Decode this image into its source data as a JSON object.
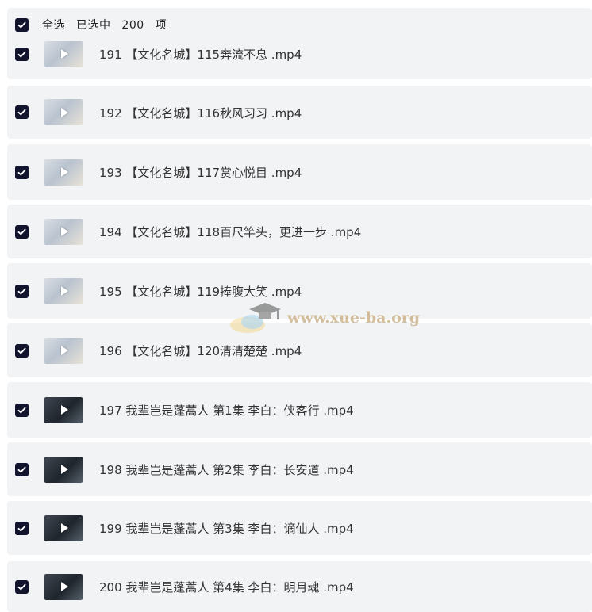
{
  "header": {
    "select_all_label": "全选",
    "selected_label": "已选中",
    "selected_count": "200",
    "unit_label": "项"
  },
  "files": [
    {
      "name": "191 【文化名城】115奔流不息 .mp4",
      "thumb": "light"
    },
    {
      "name": "192 【文化名城】116秋风习习 .mp4",
      "thumb": "light"
    },
    {
      "name": "193 【文化名城】117赏心悦目 .mp4",
      "thumb": "light"
    },
    {
      "name": "194 【文化名城】118百尺竿头，更进一步 .mp4",
      "thumb": "light"
    },
    {
      "name": "195 【文化名城】119捧腹大笑 .mp4",
      "thumb": "light"
    },
    {
      "name": "196 【文化名城】120清清楚楚 .mp4",
      "thumb": "light"
    },
    {
      "name": "197 我辈岂是蓬蒿人 第1集 李白：侠客行 .mp4",
      "thumb": "dark"
    },
    {
      "name": "198 我辈岂是蓬蒿人 第2集 李白：长安道 .mp4",
      "thumb": "dark"
    },
    {
      "name": "199 我辈岂是蓬蒿人 第3集 李白：谪仙人 .mp4",
      "thumb": "dark"
    },
    {
      "name": "200 我辈岂是蓬蒿人 第4集 李白：明月魂 .mp4",
      "thumb": "dark"
    }
  ],
  "icons": {
    "checkbox": "checkmark-icon",
    "thumbnail": "play-icon"
  },
  "colors": {
    "checkbox_bg": "#12142e",
    "row_bg": "#f2f3f5",
    "text": "#333333"
  },
  "watermark": {
    "text": "www.xue-ba.org"
  }
}
